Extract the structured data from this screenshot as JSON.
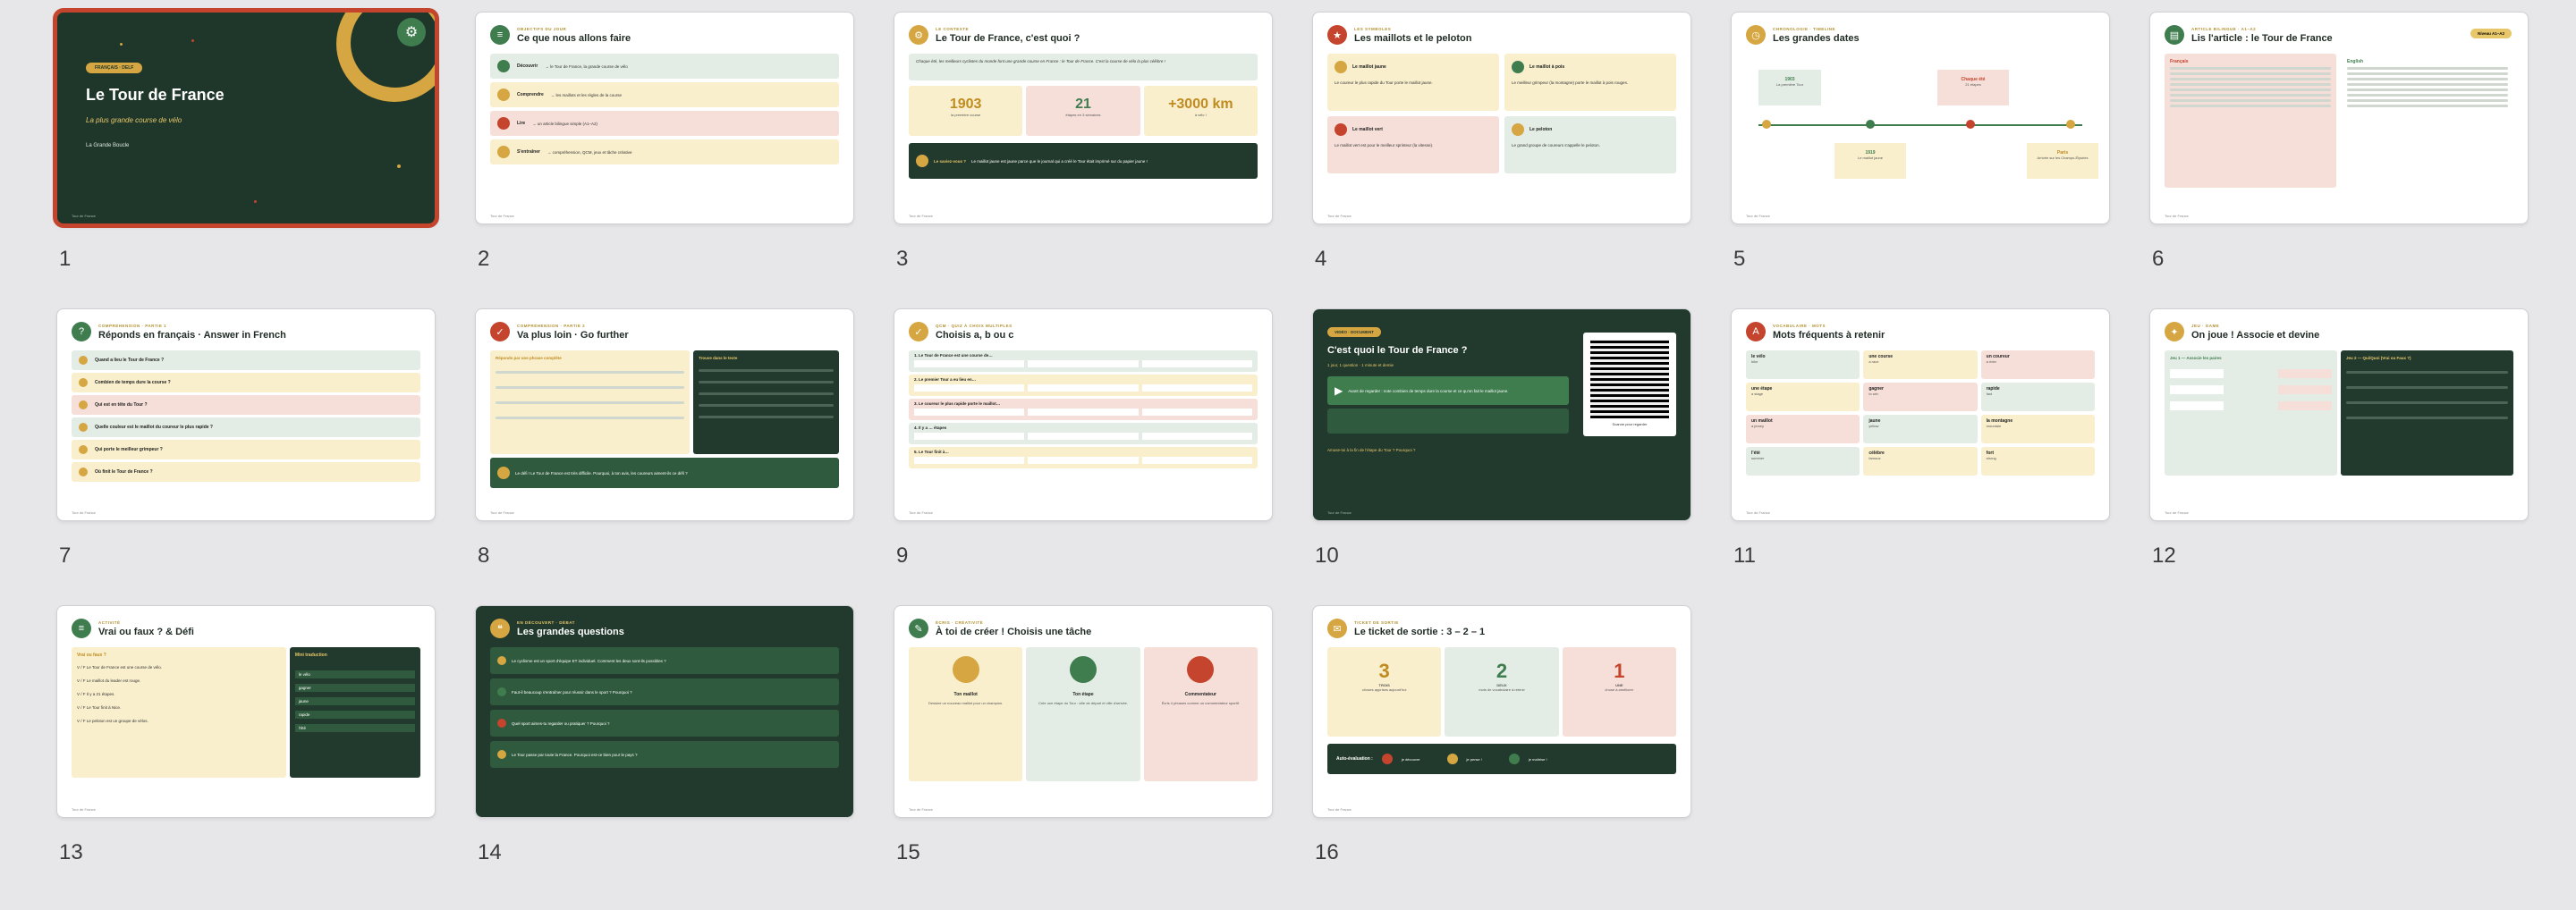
{
  "slide_numbers": [
    "1",
    "2",
    "3",
    "4",
    "5",
    "6",
    "7",
    "8",
    "9",
    "10",
    "11",
    "12",
    "13",
    "14",
    "15",
    "16"
  ],
  "s1": {
    "badge": "FRANÇAIS · DELF",
    "title": "Le Tour de France",
    "subtitle": "La plus grande course de vélo",
    "tag": "La Grande Boucle",
    "icon": "bicycle-icon"
  },
  "s2": {
    "kicker": "OBJECTIFS DU JOUR",
    "title": "Ce que nous allons faire",
    "rows": [
      {
        "label": "Découvrir",
        "text": "→ le Tour de France, la grande course de vélo"
      },
      {
        "label": "Comprendre",
        "text": "→ les maillots et les règles de la course"
      },
      {
        "label": "Lire",
        "text": "→ un article bilingue simple (A1–A2)"
      },
      {
        "label": "S'entraîner",
        "text": "→ compréhension, QCM, jeux et tâche créative"
      }
    ]
  },
  "s3": {
    "kicker": "LE CONTEXTE",
    "title": "Le Tour de France, c'est quoi ?",
    "intro": "Chaque été, les meilleurs cyclistes du monde font une grande course en France : le Tour de France. C'est la course de vélo la plus célèbre !",
    "stats": [
      {
        "value": "1903",
        "label": "la première course"
      },
      {
        "value": "21",
        "label": "étapes en 3 semaines"
      },
      {
        "value": "+3000 km",
        "label": "à vélo !"
      }
    ],
    "fact": "Le maillot jaune est jaune parce que le journal qui a créé le Tour était imprimé sur du papier jaune !",
    "fact_label": "Le saviez-vous ?"
  },
  "s4": {
    "kicker": "LES SYMBOLES",
    "title": "Les maillots et le peloton",
    "boxes": [
      {
        "title": "Le maillot jaune",
        "text": "Le coureur le plus rapide du Tour porte le maillot jaune."
      },
      {
        "title": "Le maillot à pois",
        "text": "Le meilleur grimpeur (la montagne) porte le maillot à pois rouges."
      },
      {
        "title": "Le maillot vert",
        "text": "Le maillot vert est pour le meilleur sprinteur (la vitesse)."
      },
      {
        "title": "Le peloton",
        "text": "Le grand groupe de coureurs s'appelle le peloton."
      }
    ]
  },
  "s5": {
    "kicker": "CHRONOLOGIE · TIMELINE",
    "title": "Les grandes dates",
    "events": [
      {
        "year": "1903",
        "text": "La première Tour"
      },
      {
        "year": "Chaque été",
        "text": "21 étapes"
      },
      {
        "year": "1919",
        "text": "Le maillot jaune"
      },
      {
        "year": "Paris",
        "text": "Arrivée sur les Champs-Élysées"
      }
    ]
  },
  "s6": {
    "kicker": "ARTICLE BILINGUE · A1–A2",
    "title": "Lis l'article : le Tour de France",
    "badge": "Niveau A1–A2",
    "fr_label": "Français",
    "en_label": "English"
  },
  "s7": {
    "kicker": "COMPRÉHENSION · PARTIE 1",
    "title": "Réponds en français · Answer in French",
    "questions": [
      "Quand a lieu le Tour de France ?",
      "Combien de temps dure la course ?",
      "Qui est en tête du Tour ?",
      "Quelle couleur est le maillot du coureur le plus rapide ?",
      "Qui porte le meilleur grimpeur ?",
      "Où finit le Tour de France ?"
    ]
  },
  "s8": {
    "kicker": "COMPRÉHENSION · PARTIE 2",
    "title": "Va plus loin · Go further",
    "left_head": "Réponds par une phrase complète",
    "right_head": "Trouve dans le texte",
    "defi": "Le défi ! Le Tour de France est très difficile. Pourquoi, à ton avis, les coureurs aiment-ils ce défi ?"
  },
  "s9": {
    "kicker": "QCM · QUIZ À CHOIX MULTIPLES",
    "title": "Choisis a, b ou c",
    "questions": [
      "1. Le Tour de France est une course de…",
      "2. Le premier Tour a eu lieu en…",
      "3. Le coureur le plus rapide porte le maillot…",
      "4. Il y a … étapes",
      "5. Le Tour finit à…"
    ]
  },
  "s10": {
    "badge": "VIDÉO · DOCUMENT",
    "title": "C'est quoi le Tour de France ?",
    "meta": "1 jour, 1 question · 1 minute et demie",
    "watch": "Avant de regarder : note combien de temps dure la course et ce qu'on fait le maillot jaune.",
    "qr_caption": "Scanne pour regarder",
    "note": "Amuse-toi à la fin de l'étape du Tour ? Pourquoi ?"
  },
  "s11": {
    "kicker": "VOCABULAIRE · MOTS",
    "title": "Mots fréquents à retenir",
    "words": [
      {
        "fr": "le vélo",
        "en": "bike"
      },
      {
        "fr": "une course",
        "en": "a race"
      },
      {
        "fr": "un coureur",
        "en": "a rider"
      },
      {
        "fr": "une étape",
        "en": "a stage"
      },
      {
        "fr": "gagner",
        "en": "to win"
      },
      {
        "fr": "rapide",
        "en": "fast"
      },
      {
        "fr": "un maillot",
        "en": "a jersey"
      },
      {
        "fr": "jaune",
        "en": "yellow"
      },
      {
        "fr": "la montagne",
        "en": "mountain"
      },
      {
        "fr": "l'été",
        "en": "summer"
      },
      {
        "fr": "célèbre",
        "en": "famous"
      },
      {
        "fr": "fort",
        "en": "strong"
      }
    ]
  },
  "s12": {
    "kicker": "JEU · GAME",
    "title": "On joue ! Associe et devine",
    "left_head": "Jeu 1 — Associe les paires",
    "right_head": "Jeu 2 — Qui/Quoi (Vrai ou Faux ?)"
  },
  "s13": {
    "kicker": "ACTIVITÉ",
    "title": "Vrai ou faux ? & Défi",
    "vf_head": "Vrai ou faux ?",
    "trad_head": "Mini traduction",
    "items": [
      "V / F  Le Tour de France est une course de vélo.",
      "V / F  Le maillot du leader est rouge.",
      "V / F  Il y a 21 étapes.",
      "V / F  Le Tour finit à Nice.",
      "V / F  Le peloton est un groupe de vélos."
    ],
    "trad": [
      "le vélo",
      "gagner",
      "jaune",
      "rapide",
      "l'été"
    ]
  },
  "s14": {
    "kicker": "EN DÉCOUVERT · DÉBAT",
    "title": "Les grandes questions",
    "questions": [
      "Le cyclisme est un sport d'équipe ET individuel. Comment les deux sont-ils possibles ?",
      "Faut-il beaucoup s'entraîner pour réussir dans le sport ? Pourquoi ?",
      "Quel sport aimes-tu regarder ou pratiquer ? Pourquoi ?",
      "Le Tour passe par toute la France. Pourquoi est-ce bien pour le pays ?"
    ]
  },
  "s15": {
    "kicker": "ÉCRIS · CRÉATIVITÉ",
    "title": "À toi de créer ! Choisis une tâche",
    "tasks": [
      {
        "name": "Ton maillot",
        "text": "Dessine un nouveau maillot pour un champion."
      },
      {
        "name": "Ton étape",
        "text": "Crée une étape du Tour : ville de départ et ville d'arrivée."
      },
      {
        "name": "Commentateur",
        "text": "Écris 4 phrases comme un commentateur sportif."
      }
    ]
  },
  "s16": {
    "kicker": "TICKET DE SORTIE",
    "title": "Le ticket de sortie : 3 – 2 – 1",
    "cols": [
      {
        "n": "3",
        "w": "TROIS",
        "t": "choses apprises aujourd'hui"
      },
      {
        "n": "2",
        "w": "DEUX",
        "t": "mots de vocabulaire à retenir"
      },
      {
        "n": "1",
        "w": "UNE",
        "t": "chose à améliorer"
      }
    ],
    "auto": "Auto-évaluation :",
    "levels": [
      "je découvre",
      "je pense !",
      "je maîtrise !"
    ]
  },
  "footer": "Tour de France"
}
